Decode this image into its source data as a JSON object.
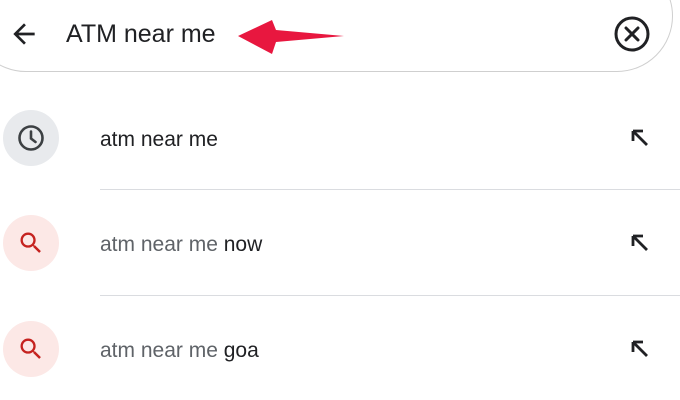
{
  "search": {
    "query": "ATM near me",
    "back_icon": "arrow-left-icon",
    "clear_icon": "clear-circle-icon",
    "annotation_arrow_color": "#e8173f"
  },
  "suggestions": [
    {
      "type": "history",
      "icon": "history-clock-icon",
      "matched": "atm near me",
      "rest": "",
      "fill_icon": "north-west-arrow-icon"
    },
    {
      "type": "search",
      "icon": "search-magnifier-icon",
      "matched": "atm near me",
      "rest": " now",
      "fill_icon": "north-west-arrow-icon"
    },
    {
      "type": "search",
      "icon": "search-magnifier-icon",
      "matched": "atm near me",
      "rest": " goa",
      "fill_icon": "north-west-arrow-icon"
    }
  ],
  "colors": {
    "text_primary": "#202124",
    "text_secondary": "#5f6368",
    "history_icon_bg": "#e8eaed",
    "search_icon_bg": "#fce8e6",
    "search_icon": "#c5221f",
    "divider": "#dadce0"
  }
}
